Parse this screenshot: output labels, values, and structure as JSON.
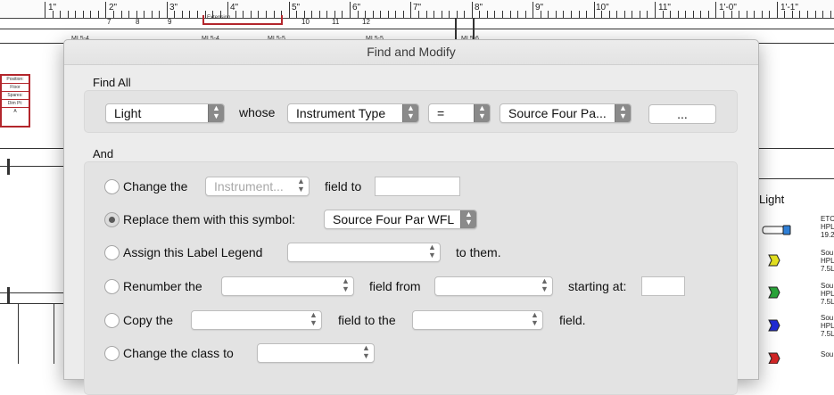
{
  "ruler": {
    "labels": [
      "1\"",
      "2\"",
      "3\"",
      "4\"",
      "5\"",
      "6\"",
      "7\"",
      "8\"",
      "9\"",
      "10\"",
      "11\"",
      "1'-0\"",
      "1'-1\""
    ],
    "sub_labels": [
      "7",
      "8",
      "9",
      "10",
      "11",
      "12"
    ]
  },
  "drawing": {
    "mi_labels": [
      "MI 5-4",
      "MI 5-4",
      "MI 5-5",
      "MI 5-5",
      "MI 5-6"
    ],
    "extension_label": "Extension",
    "position_box": {
      "position_label": "Position:",
      "position_value": "Floor",
      "spares_label": "Spares:",
      "dim_label": "Dim Pt:",
      "dim_value": "A"
    }
  },
  "legend": {
    "title": "Light",
    "entries": [
      [
        "ETC",
        "HPL",
        "19.2"
      ],
      [
        "Sou",
        "HPL",
        "7.5L"
      ],
      [
        "Sou",
        "HPL",
        "7.5L"
      ],
      [
        "Sou",
        "HPL",
        "7.5L"
      ],
      [
        "Sou"
      ]
    ],
    "symbol_colors": [
      "#2f7fd6",
      "#e5e220",
      "#2aa53a",
      "#1f2bd6",
      "#d42626"
    ]
  },
  "dialog": {
    "title": "Find and Modify",
    "find_all": {
      "label": "Find All",
      "object_type": "Light",
      "whose_label": "whose",
      "field": "Instrument Type",
      "operator": "=",
      "value": "Source Four Pa...",
      "more_button": "..."
    },
    "and_section": {
      "label": "And",
      "change_field": {
        "prefix": "Change the",
        "field": "Instrument...",
        "middle": "field to",
        "value": "",
        "selected": false
      },
      "replace_symbol": {
        "label": "Replace them with this symbol:",
        "symbol": "Source Four Par WFL",
        "selected": true
      },
      "assign_legend": {
        "prefix": "Assign this Label Legend",
        "legend": "",
        "suffix": "to them.",
        "selected": false
      },
      "renumber": {
        "prefix": "Renumber the",
        "field": "",
        "middle": "field from",
        "from_field": "",
        "starting_label": "starting at:",
        "starting_value": "",
        "selected": false
      },
      "copy": {
        "prefix": "Copy the",
        "source_field": "",
        "middle": "field to the",
        "target_field": "",
        "suffix": "field.",
        "selected": false
      },
      "change_class": {
        "prefix": "Change the class to",
        "class": "",
        "selected": false
      }
    }
  },
  "colors": {
    "dialog_bg": "#ececec",
    "groupbox_bg": "#e3e3e3",
    "highlight_red": "#b3262c"
  }
}
